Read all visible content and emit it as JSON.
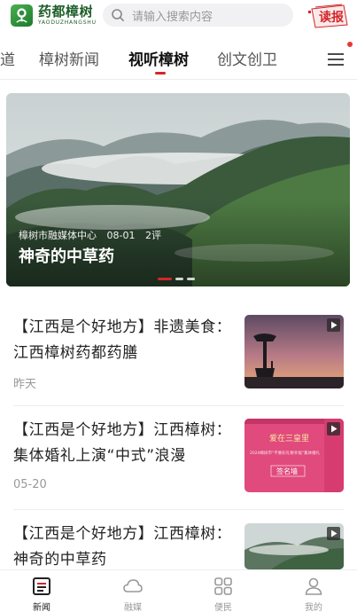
{
  "header": {
    "logo_name": "药都樟树",
    "logo_sub": "YAODUZHANGSHU",
    "search_placeholder": "请输入搜索内容",
    "dubao_label": "读报"
  },
  "tabs": [
    {
      "label": "道",
      "active": false
    },
    {
      "label": "樟树新闻",
      "active": false
    },
    {
      "label": "视听樟树",
      "active": true
    },
    {
      "label": "创文创卫",
      "active": false
    }
  ],
  "banner": {
    "source": "樟树市融媒体中心",
    "date": "08-01",
    "comments": "2评",
    "title": "神奇的中草药",
    "slide_count": 3,
    "active_slide": 1
  },
  "news": [
    {
      "title": "【江西是个好地方】非遗美食：江西樟树药都药膳",
      "time": "昨天",
      "has_video": true
    },
    {
      "title": "【江西是个好地方】江西樟树：集体婚礼上演“中式”浪漫",
      "time": "05-20",
      "has_video": true
    },
    {
      "title": "【江西是个好地方】江西樟树：神奇的中草药",
      "time": "",
      "has_video": true
    }
  ],
  "thumb_text": {
    "wall_heading": "爱在三皇里",
    "wall_subline": "2024樟树市“不要彩礼要幸福”集体婚礼",
    "wall_sign": "签名墙"
  },
  "bottom_nav": [
    {
      "label": "新闻",
      "icon": "news-icon",
      "active": true
    },
    {
      "label": "融媒",
      "icon": "cloud-icon",
      "active": false
    },
    {
      "label": "便民",
      "icon": "grid-icon",
      "active": false
    },
    {
      "label": "我的",
      "icon": "user-icon",
      "active": false
    }
  ],
  "colors": {
    "accent": "#d3252a",
    "brand_green": "#1f5e2b",
    "text_primary": "#222222",
    "text_muted": "#999999"
  }
}
